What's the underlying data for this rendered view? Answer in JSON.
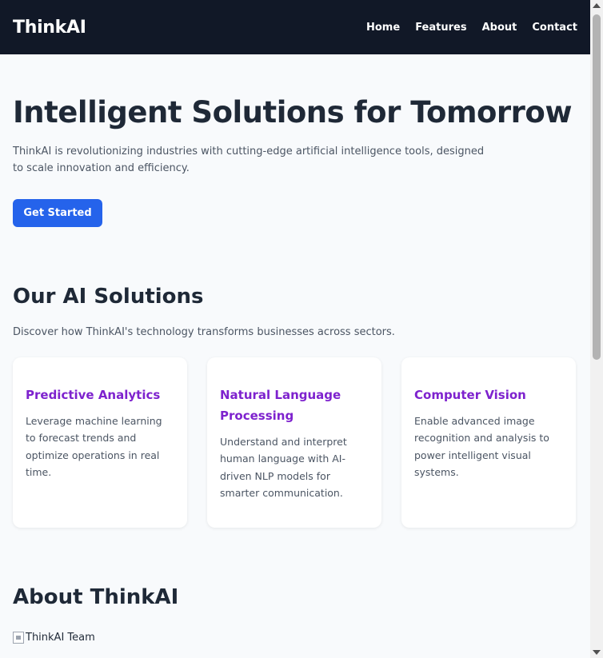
{
  "header": {
    "brand": "ThinkAI",
    "nav": [
      "Home",
      "Features",
      "About",
      "Contact"
    ]
  },
  "hero": {
    "title": "Intelligent Solutions for Tomorrow",
    "description": "ThinkAI is revolutionizing industries with cutting-edge artificial intelligence tools, designed to scale innovation and efficiency.",
    "cta_label": "Get Started"
  },
  "solutions": {
    "title": "Our AI Solutions",
    "subtitle": "Discover how ThinkAI's technology transforms businesses across sectors.",
    "cards": [
      {
        "title": "Predictive Analytics",
        "text": "Leverage machine learning to forecast trends and optimize operations in real time."
      },
      {
        "title": "Natural Language Processing",
        "text": "Understand and interpret human language with AI-driven NLP models for smarter communication."
      },
      {
        "title": "Computer Vision",
        "text": "Enable advanced image recognition and analysis to power intelligent visual systems."
      }
    ]
  },
  "about": {
    "title": "About ThinkAI",
    "image_alt": "ThinkAI Team"
  },
  "colors": {
    "header_bg": "#111827",
    "accent_button": "#2563eb",
    "card_title": "#7e22ce",
    "page_bg": "#f8fafc"
  }
}
